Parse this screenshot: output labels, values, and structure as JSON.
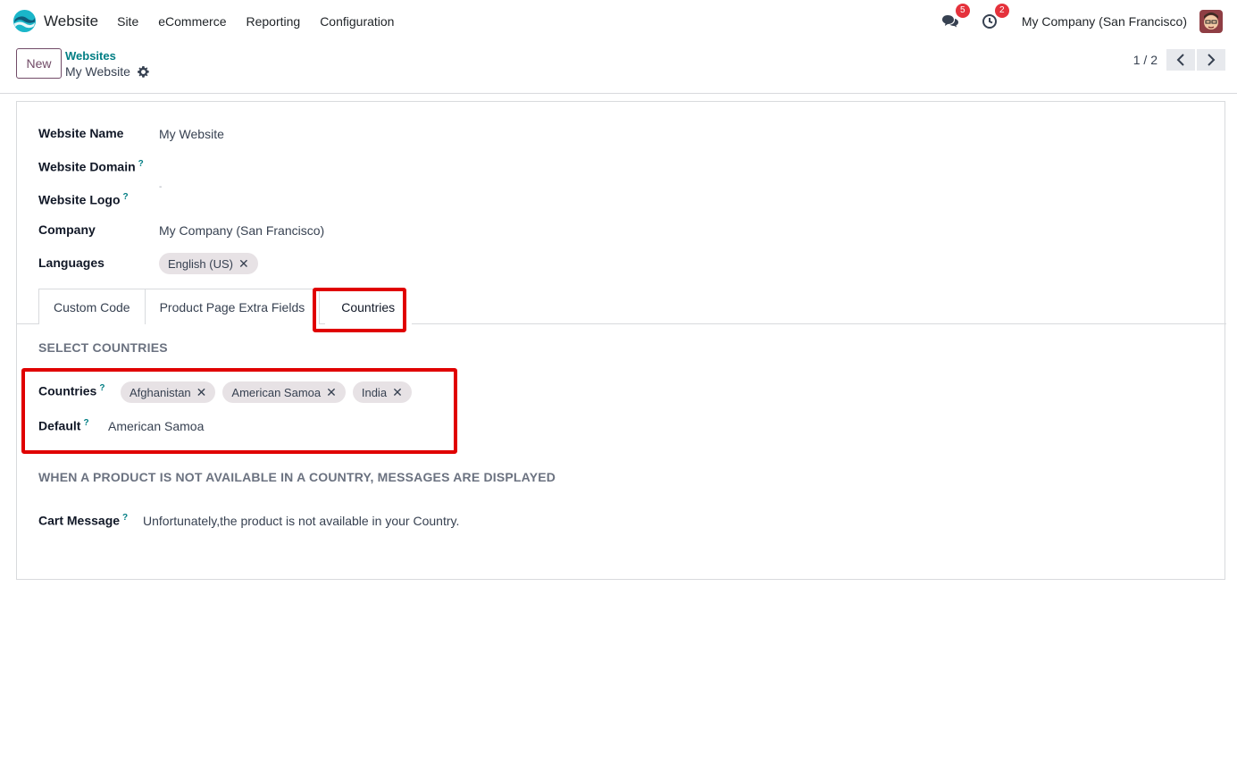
{
  "navbar": {
    "app_name": "Website",
    "menu": [
      "Site",
      "eCommerce",
      "Reporting",
      "Configuration"
    ],
    "messages_badge": "5",
    "activities_badge": "2",
    "company": "My Company (San Francisco)"
  },
  "control": {
    "new_label": "New",
    "breadcrumb": "Websites",
    "record_title": "My Website",
    "pager": "1 / 2"
  },
  "form": {
    "website_name_label": "Website Name",
    "website_name": "My Website",
    "website_domain_label": "Website Domain",
    "website_logo_label": "Website Logo",
    "website_logo_placeholder": "-",
    "company_label": "Company",
    "company": "My Company (San Francisco)",
    "languages_label": "Languages",
    "languages": [
      "English (US)"
    ],
    "help_mark": "?"
  },
  "tabs": [
    "Custom Code",
    "Product Page Extra Fields",
    "Countries"
  ],
  "countries_tab": {
    "section_title": "SELECT COUNTRIES",
    "countries_label": "Countries",
    "countries": [
      "Afghanistan",
      "American Samoa",
      "India"
    ],
    "default_label": "Default",
    "default_value": "American Samoa",
    "section2_title": "WHEN A PRODUCT IS NOT AVAILABLE IN A COUNTRY, MESSAGES ARE DISPLAYED",
    "cart_message_label": "Cart Message",
    "cart_message": "Unfortunately,the product is not available in your Country."
  },
  "colors": {
    "accent": "#714b67",
    "link": "#017e84",
    "highlight": "#e00000",
    "badge": "#e5323c"
  }
}
